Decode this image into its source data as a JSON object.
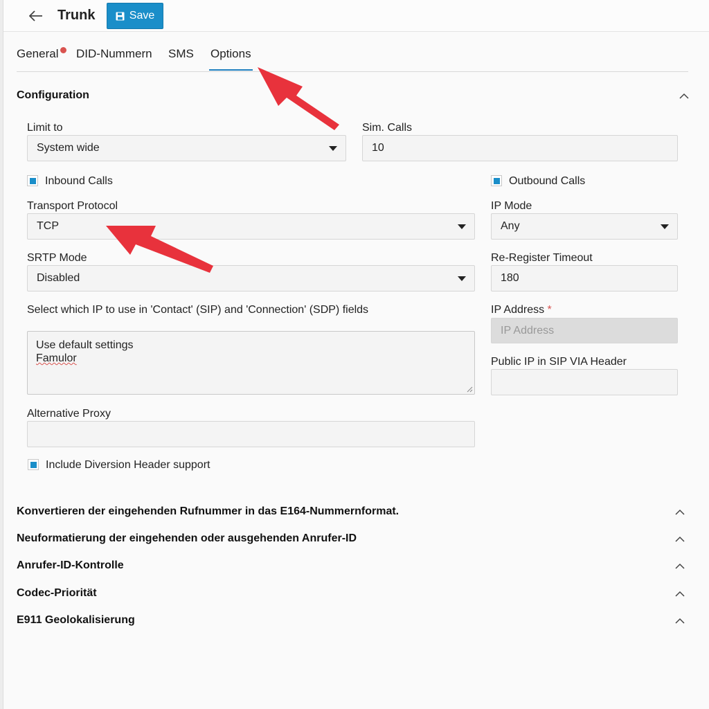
{
  "header": {
    "title": "Trunk",
    "save_label": "Save"
  },
  "tabs": [
    {
      "label": "General",
      "has_error": true
    },
    {
      "label": "DID-Nummern"
    },
    {
      "label": "SMS"
    },
    {
      "label": "Options",
      "active": true
    }
  ],
  "configuration": {
    "title": "Configuration",
    "limit_to": {
      "label": "Limit to",
      "value": "System wide"
    },
    "sim_calls": {
      "label": "Sim. Calls",
      "value": "10"
    },
    "inbound_calls": {
      "label": "Inbound Calls",
      "checked": true
    },
    "outbound_calls": {
      "label": "Outbound Calls",
      "checked": true
    },
    "transport_protocol": {
      "label": "Transport Protocol",
      "value": "TCP"
    },
    "ip_mode": {
      "label": "IP Mode",
      "value": "Any"
    },
    "srtp_mode": {
      "label": "SRTP Mode",
      "value": "Disabled"
    },
    "reregister_timeout": {
      "label": "Re-Register Timeout",
      "value": "180"
    },
    "contact_ip": {
      "label": "Select which IP to use in 'Contact' (SIP) and 'Connection' (SDP) fields",
      "options": [
        "Use default settings",
        "Famulor"
      ]
    },
    "ip_address": {
      "label": "IP Address",
      "required_mark": "*",
      "placeholder": "IP Address"
    },
    "public_ip": {
      "label": "Public IP in SIP VIA Header",
      "value": ""
    },
    "alternative_proxy": {
      "label": "Alternative Proxy",
      "value": ""
    },
    "diversion_header": {
      "label": "Include Diversion Header support",
      "checked": true
    }
  },
  "sections": [
    {
      "title": "Konvertieren der eingehenden Rufnummer in das E164-Nummernformat."
    },
    {
      "title": "Neuformatierung der eingehenden oder ausgehenden Anrufer-ID"
    },
    {
      "title": "Anrufer-ID-Kontrolle"
    },
    {
      "title": "Codec-Priorität"
    },
    {
      "title": "E911 Geolokalisierung"
    }
  ],
  "colors": {
    "accent": "#1a8ec9",
    "annotation_arrow": "#e8323c",
    "error_dot": "#d9534f"
  }
}
